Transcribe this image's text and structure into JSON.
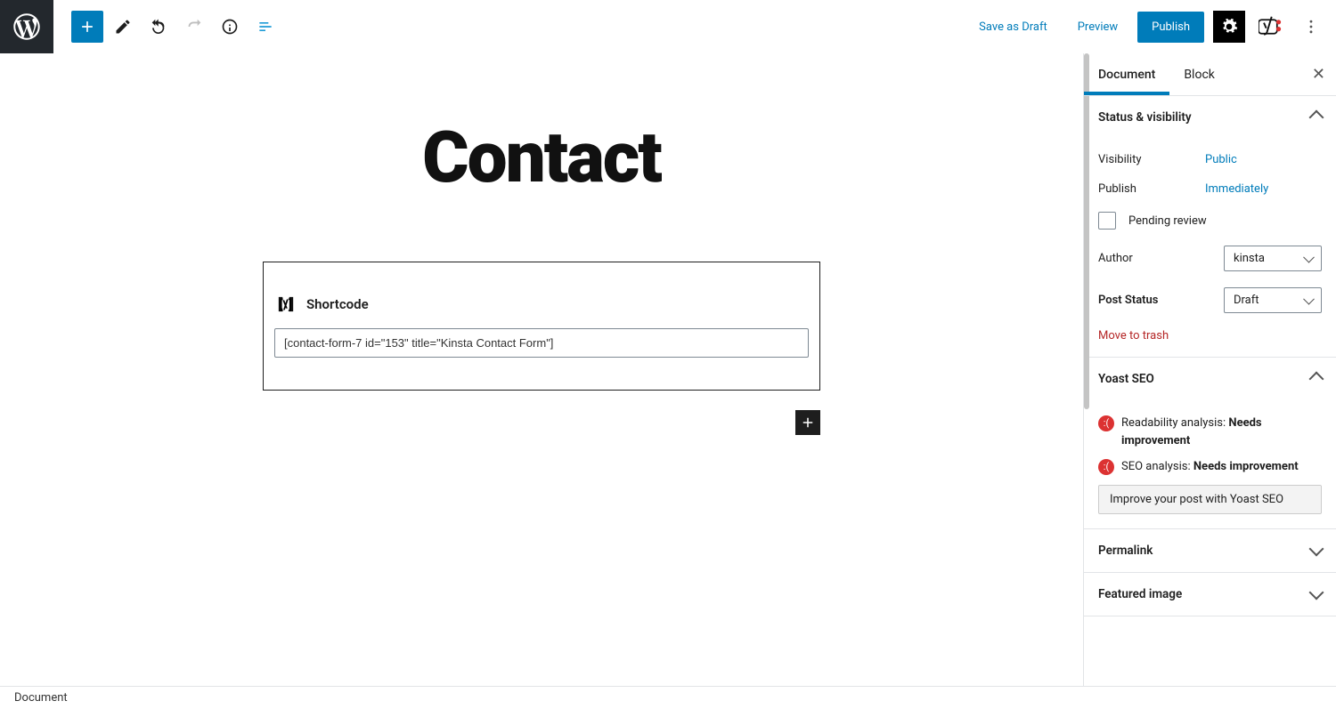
{
  "header": {
    "save_draft": "Save as Draft",
    "preview": "Preview",
    "publish": "Publish"
  },
  "editor": {
    "title": "Contact",
    "block_label": "Shortcode",
    "shortcode_value": "[contact-form-7 id=\"153\" title=\"Kinsta Contact Form\"]"
  },
  "sidebar": {
    "tabs": {
      "document": "Document",
      "block": "Block"
    },
    "panels": {
      "status": {
        "title": "Status & visibility",
        "visibility_label": "Visibility",
        "visibility_value": "Public",
        "publish_label": "Publish",
        "publish_value": "Immediately",
        "pending_label": "Pending review",
        "author_label": "Author",
        "author_value": "kinsta",
        "post_status_label": "Post Status",
        "post_status_value": "Draft",
        "trash": "Move to trash"
      },
      "yoast": {
        "title": "Yoast SEO",
        "readability_label": "Readability analysis: ",
        "readability_value": "Needs improvement",
        "seo_label": "SEO analysis: ",
        "seo_value": "Needs improvement",
        "improve_btn": "Improve your post with Yoast SEO"
      },
      "permalink": {
        "title": "Permalink"
      },
      "featured": {
        "title": "Featured image"
      }
    }
  },
  "footer": {
    "breadcrumb": "Document"
  }
}
